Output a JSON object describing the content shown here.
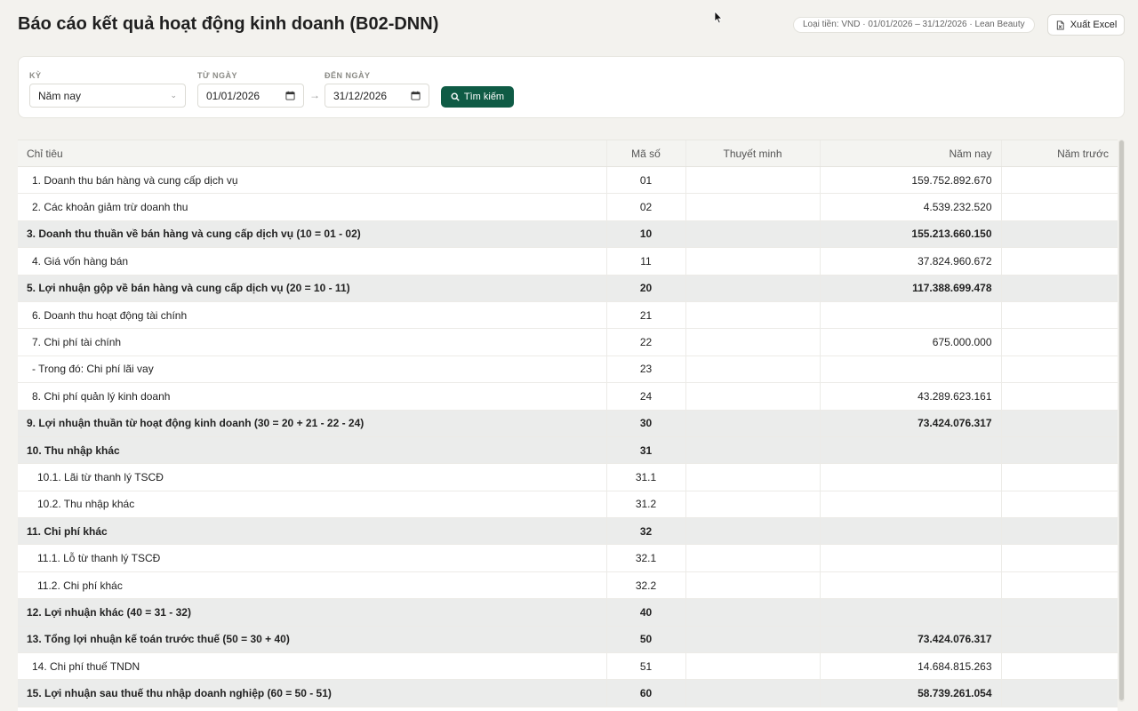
{
  "header": {
    "title": "Báo cáo kết quả hoạt động kinh doanh (B02-DNN)",
    "meta": "Loại tiền: VND · 01/01/2026 – 31/12/2026 · Lean Beauty",
    "export_label": "Xuất Excel"
  },
  "filters": {
    "period_label": "Kỳ",
    "period_value": "Năm nay",
    "from_label": "Từ ngày",
    "from_value": "01/01/2026",
    "to_label": "Đến ngày",
    "to_value": "31/12/2026",
    "search_label": "Tìm kiếm"
  },
  "table": {
    "columns": [
      "Chỉ tiêu",
      "Mã số",
      "Thuyết minh",
      "Năm nay",
      "Năm trước"
    ],
    "rows": [
      {
        "name": "1. Doanh thu bán hàng và cung cấp dịch vụ",
        "code": "01",
        "note": "",
        "current": "159.752.892.670",
        "previous": "",
        "bold": false,
        "level": 1
      },
      {
        "name": "2. Các khoản giảm trừ doanh thu",
        "code": "02",
        "note": "",
        "current": "4.539.232.520",
        "previous": "",
        "bold": false,
        "level": 1
      },
      {
        "name": "3. Doanh thu thuần về bán hàng và cung cấp dịch vụ (10 = 01 - 02)",
        "code": "10",
        "note": "",
        "current": "155.213.660.150",
        "previous": "",
        "bold": true,
        "level": 0
      },
      {
        "name": "4. Giá vốn hàng bán",
        "code": "11",
        "note": "",
        "current": "37.824.960.672",
        "previous": "",
        "bold": false,
        "level": 1
      },
      {
        "name": "5. Lợi nhuận gộp về bán hàng và cung cấp dịch vụ (20 = 10 - 11)",
        "code": "20",
        "note": "",
        "current": "117.388.699.478",
        "previous": "",
        "bold": true,
        "level": 0
      },
      {
        "name": "6. Doanh thu hoạt động tài chính",
        "code": "21",
        "note": "",
        "current": "",
        "previous": "",
        "bold": false,
        "level": 1
      },
      {
        "name": "7. Chi phí tài chính",
        "code": "22",
        "note": "",
        "current": "675.000.000",
        "previous": "",
        "bold": false,
        "level": 1
      },
      {
        "name": "- Trong đó: Chi phí lãi vay",
        "code": "23",
        "note": "",
        "current": "",
        "previous": "",
        "bold": false,
        "level": 1
      },
      {
        "name": "8. Chi phí quản lý kinh doanh",
        "code": "24",
        "note": "",
        "current": "43.289.623.161",
        "previous": "",
        "bold": false,
        "level": 1
      },
      {
        "name": "9. Lợi nhuận thuần từ hoạt động kinh doanh (30 = 20 + 21 - 22 - 24)",
        "code": "30",
        "note": "",
        "current": "73.424.076.317",
        "previous": "",
        "bold": true,
        "level": 0
      },
      {
        "name": "10. Thu nhập khác",
        "code": "31",
        "note": "",
        "current": "",
        "previous": "",
        "bold": true,
        "level": 0
      },
      {
        "name": "10.1. Lãi từ thanh lý TSCĐ",
        "code": "31.1",
        "note": "",
        "current": "",
        "previous": "",
        "bold": false,
        "level": 2
      },
      {
        "name": "10.2. Thu nhập khác",
        "code": "31.2",
        "note": "",
        "current": "",
        "previous": "",
        "bold": false,
        "level": 2
      },
      {
        "name": "11. Chi phí khác",
        "code": "32",
        "note": "",
        "current": "",
        "previous": "",
        "bold": true,
        "level": 0
      },
      {
        "name": "11.1. Lỗ từ thanh lý TSCĐ",
        "code": "32.1",
        "note": "",
        "current": "",
        "previous": "",
        "bold": false,
        "level": 2
      },
      {
        "name": "11.2. Chi phí khác",
        "code": "32.2",
        "note": "",
        "current": "",
        "previous": "",
        "bold": false,
        "level": 2
      },
      {
        "name": "12. Lợi nhuận khác (40 = 31 - 32)",
        "code": "40",
        "note": "",
        "current": "",
        "previous": "",
        "bold": true,
        "level": 0
      },
      {
        "name": "13. Tổng lợi nhuận kế toán trước thuế (50 = 30 + 40)",
        "code": "50",
        "note": "",
        "current": "73.424.076.317",
        "previous": "",
        "bold": true,
        "level": 0
      },
      {
        "name": "14. Chi phí thuế TNDN",
        "code": "51",
        "note": "",
        "current": "14.684.815.263",
        "previous": "",
        "bold": false,
        "level": 1
      },
      {
        "name": "15. Lợi nhuận sau thuế thu nhập doanh nghiệp (60 = 50 - 51)",
        "code": "60",
        "note": "",
        "current": "58.739.261.054",
        "previous": "",
        "bold": true,
        "level": 0
      }
    ]
  },
  "icons": {
    "export": "excel-file-icon",
    "search": "search-icon",
    "calendar": "calendar-icon",
    "chevron": "chevron-down-icon",
    "arrow": "arrow-right-icon"
  },
  "colors": {
    "accent": "#0f5b45",
    "background": "#f3f2ee",
    "bold_row": "#ebeceb"
  }
}
